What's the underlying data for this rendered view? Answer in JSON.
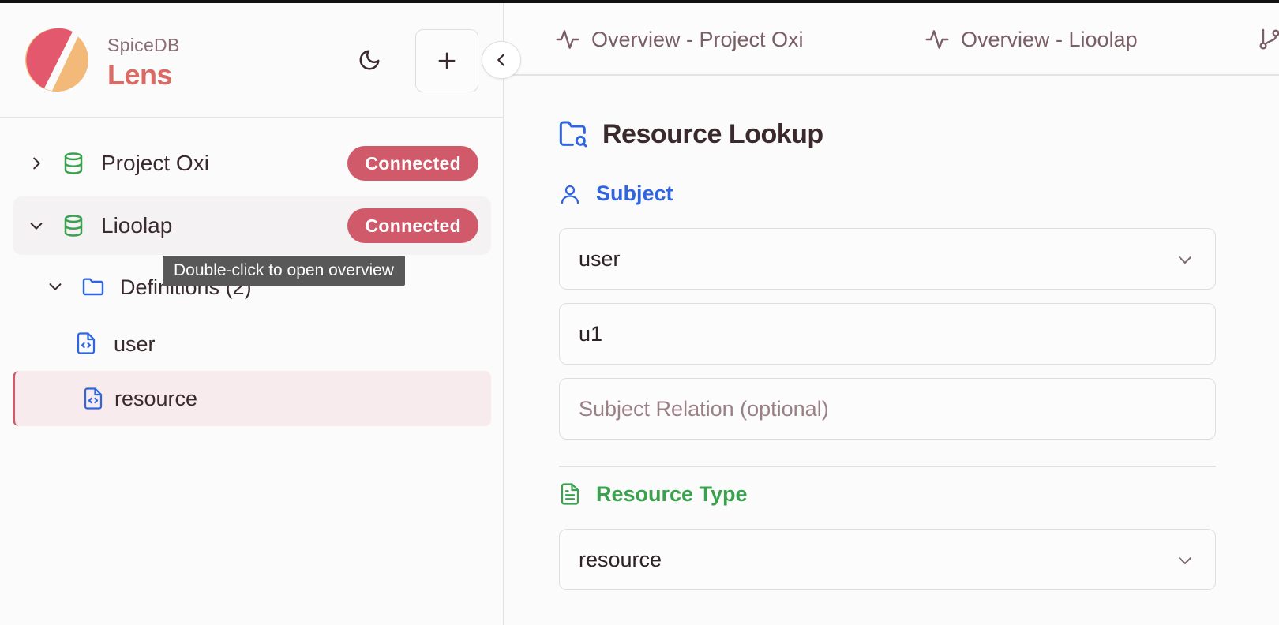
{
  "app": {
    "brand_small": "SpiceDB",
    "brand_big": "Lens"
  },
  "tabs": [
    {
      "label": "Overview - Project Oxi",
      "icon": "activity-icon"
    },
    {
      "label": "Overview - Lioolap",
      "icon": "activity-icon"
    }
  ],
  "sidebar": {
    "connections": [
      {
        "name": "Project Oxi",
        "status": "Connected",
        "expanded": false
      },
      {
        "name": "Lioolap",
        "status": "Connected",
        "expanded": true
      }
    ],
    "folder": {
      "label": "Definitions (2)"
    },
    "definitions": [
      {
        "name": "user"
      },
      {
        "name": "resource",
        "selected": true
      }
    ],
    "tooltip": "Double-click to open overview"
  },
  "main": {
    "title": "Resource Lookup",
    "subject_label": "Subject",
    "subject_type": "user",
    "subject_id": "u1",
    "subject_relation_placeholder": "Subject Relation (optional)",
    "resource_type_label": "Resource Type",
    "resource_type": "resource"
  },
  "colors": {
    "accent": "#d15a6a",
    "subject_blue": "#2f66e0",
    "resource_green": "#3aa14f",
    "db_green": "#3aa14f"
  }
}
